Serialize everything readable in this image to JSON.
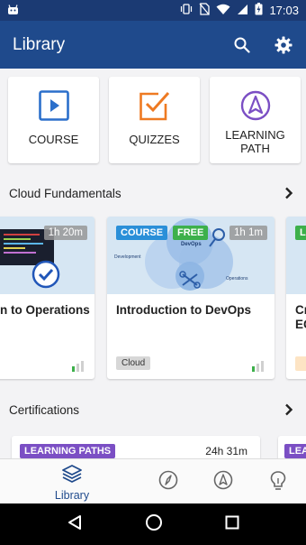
{
  "status_bar": {
    "time": "17:03"
  },
  "app_bar": {
    "title": "Library",
    "icons": [
      "search-icon",
      "settings-icon"
    ]
  },
  "quick_links": [
    {
      "label": "COURSE",
      "icon": "play-icon",
      "color": "#2b6fcb"
    },
    {
      "label": "QUIZZES",
      "icon": "quiz-check-icon",
      "color": "#ee7a22"
    },
    {
      "label": "LEARNING\nPATH",
      "label_line1": "LEARNING",
      "label_line2": "PATH",
      "icon": "learning-path-icon",
      "color": "#7b4fc4"
    }
  ],
  "sections": [
    {
      "title": "Cloud Fundamentals"
    },
    {
      "title": "Certifications"
    }
  ],
  "cloud_courses": [
    {
      "title": "n to Operations",
      "duration": "1h 20m",
      "badges": [],
      "tag": ""
    },
    {
      "title": "Introduction to DevOps",
      "duration": "1h 1m",
      "badges": [
        "COURSE",
        "FREE"
      ],
      "tag": "Cloud",
      "thumb_labels": {
        "center": "DevOps",
        "left": "Development",
        "right": "Operations"
      }
    },
    {
      "title": "Cr\nEC",
      "title_line1": "Cr",
      "title_line2": "EC",
      "duration": "",
      "badges": [
        "LA"
      ],
      "tag": ""
    }
  ],
  "certifications": [
    {
      "badge": "LEARNING PATHS",
      "duration": "24h 31m"
    },
    {
      "badge": "LEA",
      "duration": ""
    }
  ],
  "bottom_nav": [
    {
      "label": "Library",
      "icon": "library-icon",
      "active": true
    },
    {
      "label": "",
      "icon": "compass-icon",
      "active": false
    },
    {
      "label": "",
      "icon": "learning-path-nav-icon",
      "active": false
    },
    {
      "label": "",
      "icon": "lightbulb-icon",
      "active": false
    }
  ],
  "colors": {
    "primary": "#1f4a8c",
    "status_bar": "#1b3a73",
    "course_badge": "#2a8fd8",
    "free_badge": "#3db04b",
    "learning_paths_badge": "#7b4fc4"
  }
}
